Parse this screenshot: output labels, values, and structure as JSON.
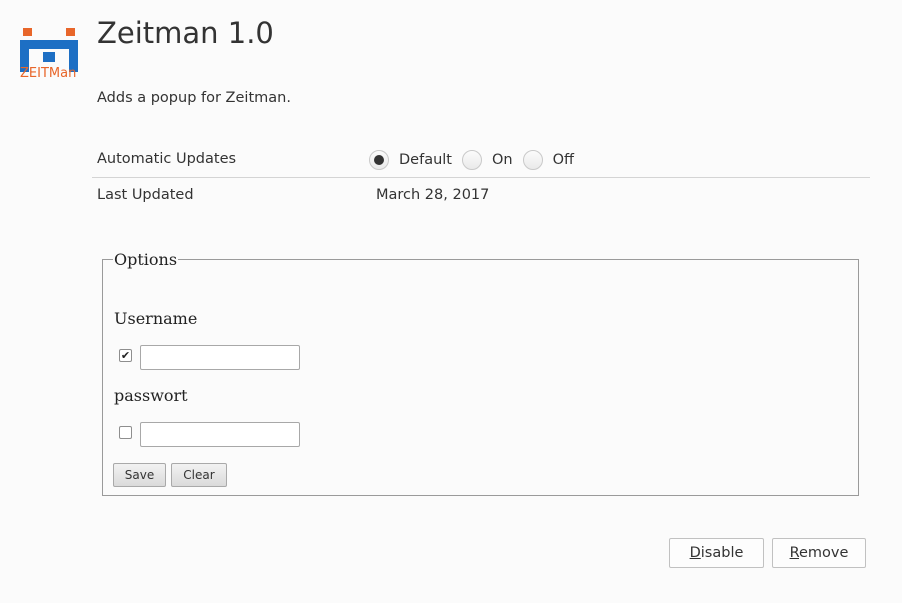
{
  "header": {
    "logo_text": "ZEITMan",
    "logo_icon": "zeitman-logo-icon",
    "title": "Zeitman 1.0",
    "description": "Adds a popup for Zeitman."
  },
  "details": {
    "automatic_updates_label": "Automatic Updates",
    "update_options": [
      {
        "label": "Default",
        "selected": true
      },
      {
        "label": "On",
        "selected": false
      },
      {
        "label": "Off",
        "selected": false
      }
    ],
    "last_updated_label": "Last Updated",
    "last_updated_value": "March 28, 2017"
  },
  "options": {
    "legend": "Options",
    "username_label": "Username",
    "username_checked": true,
    "username_value": "",
    "password_label": "passwort",
    "password_checked": false,
    "password_value": "",
    "save_label": "Save",
    "clear_label": "Clear"
  },
  "actions": {
    "disable_label": "Disable",
    "remove_label": "Remove"
  },
  "colors": {
    "logo_blue": "#1d6fc4",
    "logo_orange": "#e8662a"
  }
}
